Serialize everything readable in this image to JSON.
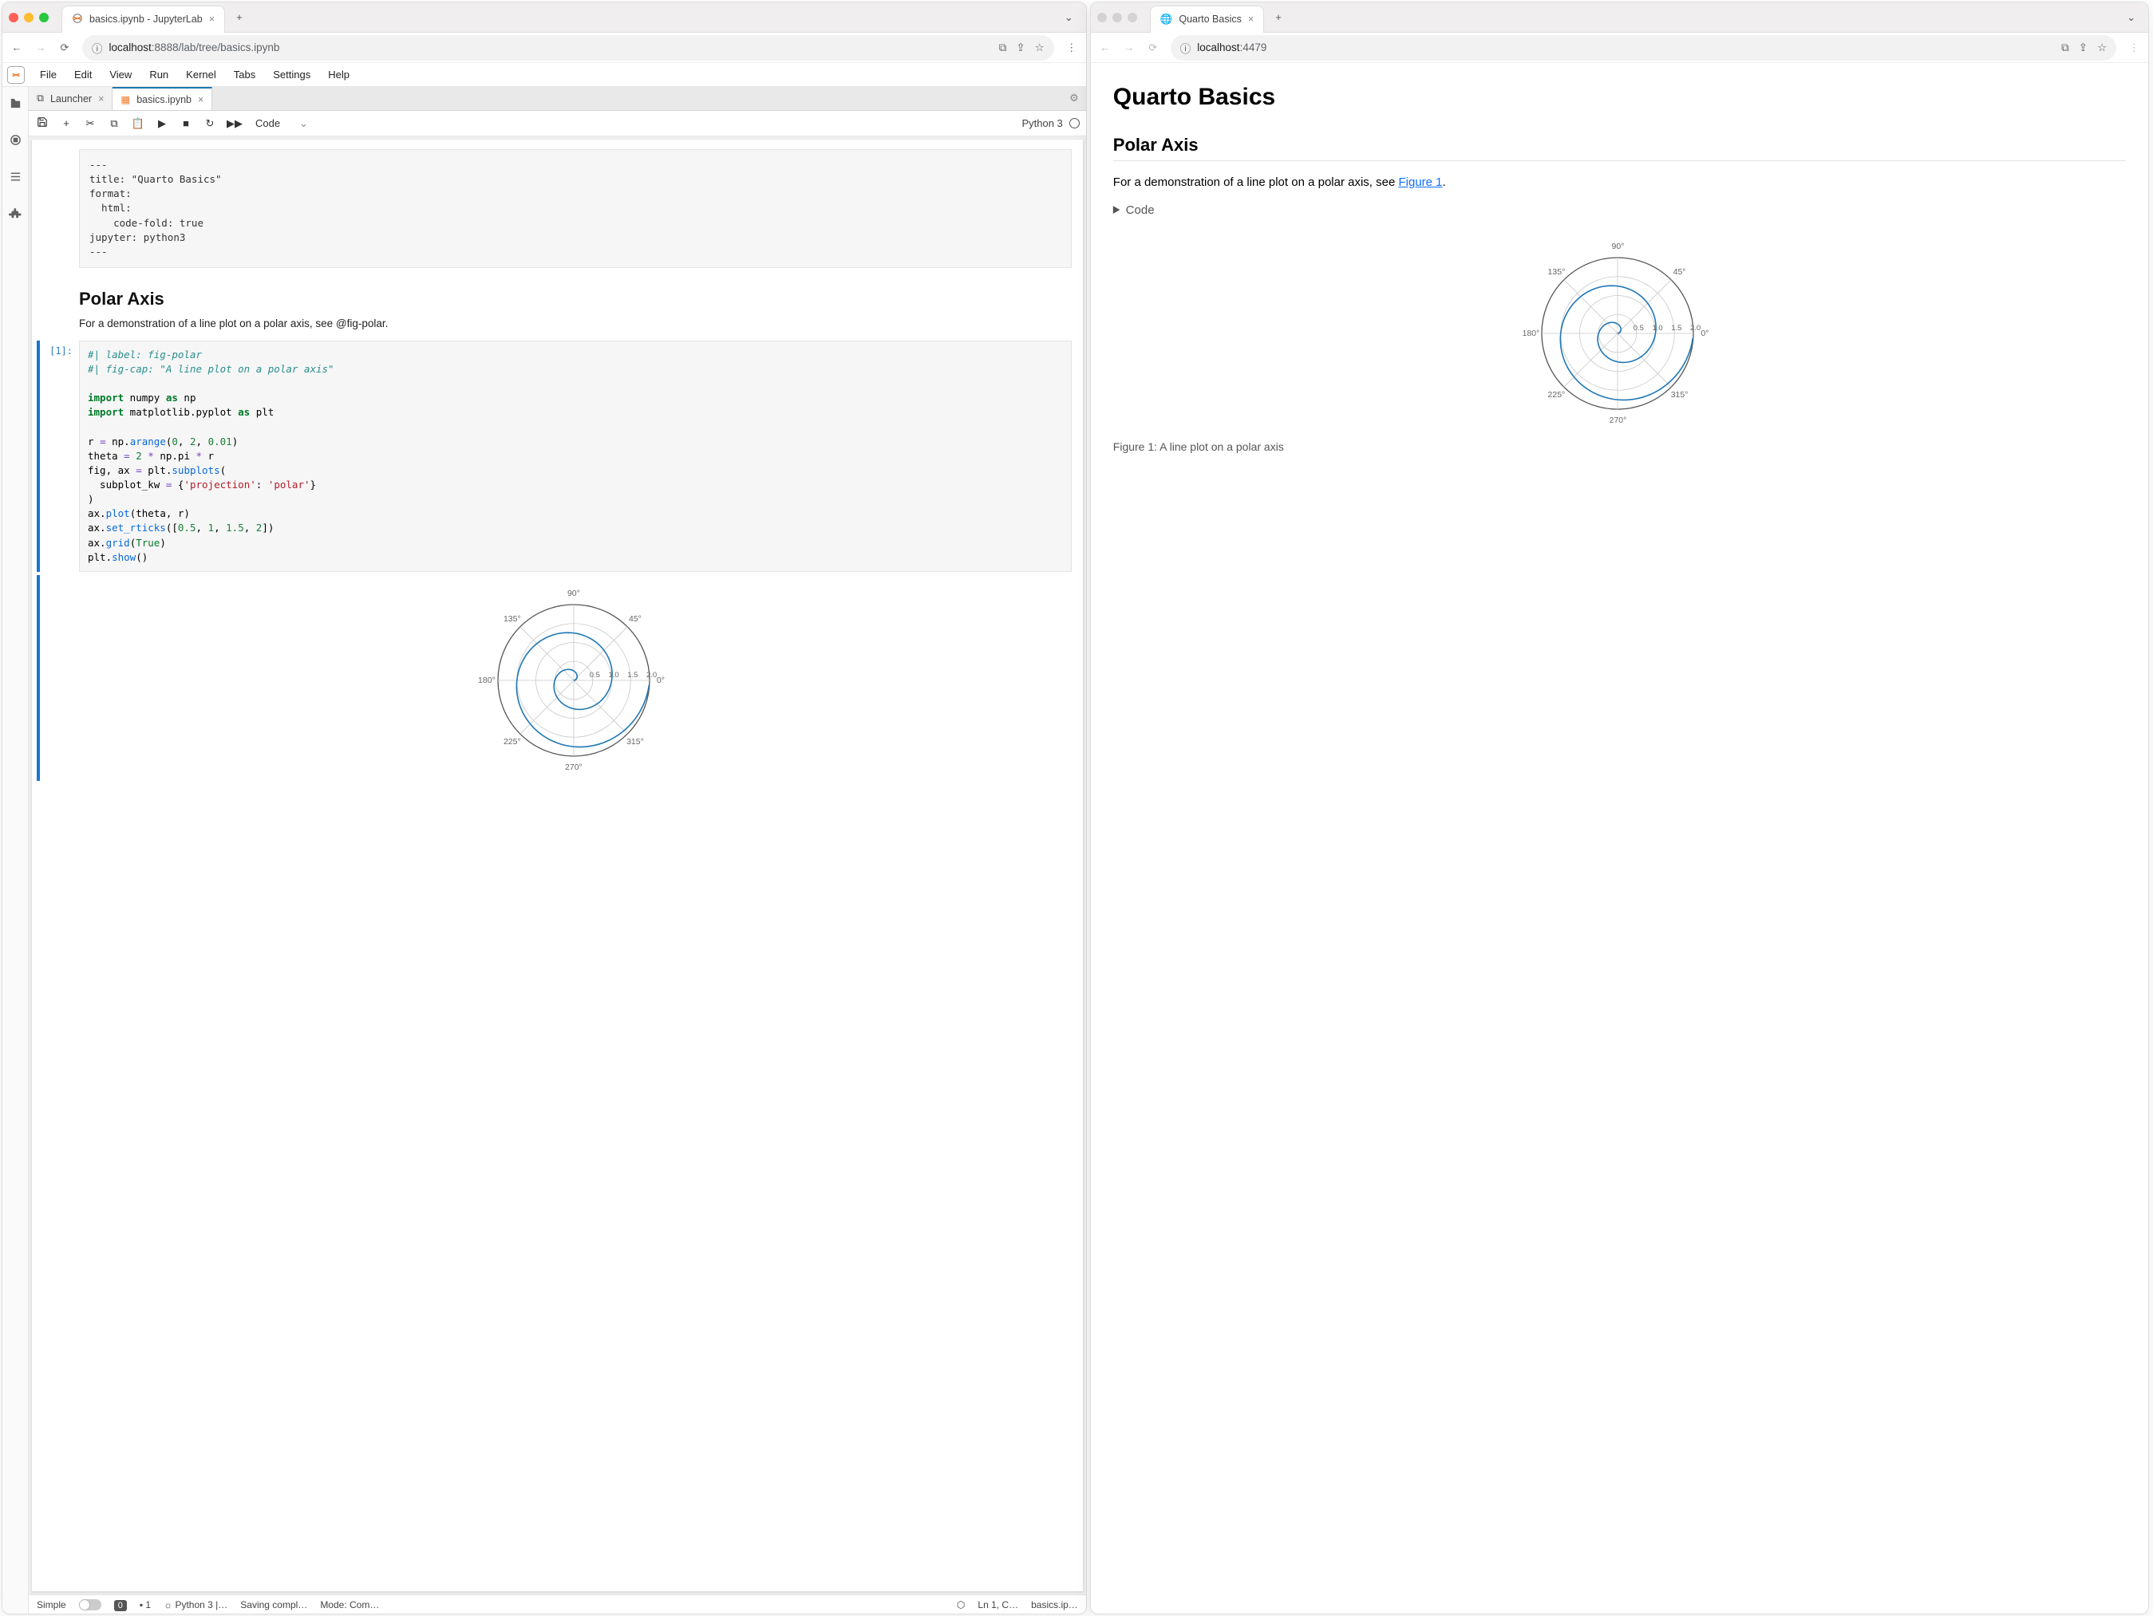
{
  "left_browser": {
    "tab_title": "basics.ipynb - JupyterLab",
    "url_host": "localhost",
    "url_port": ":8888",
    "url_path": "/lab/tree/basics.ipynb"
  },
  "right_browser": {
    "tab_title": "Quarto Basics",
    "url_host": "localhost",
    "url_port": ":4479",
    "url_path": ""
  },
  "jupyter": {
    "menu": [
      "File",
      "Edit",
      "View",
      "Run",
      "Kernel",
      "Tabs",
      "Settings",
      "Help"
    ],
    "doc_tabs": [
      {
        "label": "Launcher",
        "active": false,
        "icon": "launcher"
      },
      {
        "label": "basics.ipynb",
        "active": true,
        "icon": "nb"
      }
    ],
    "toolbar_celltype": "Code",
    "kernel_label": "Python 3",
    "raw_cell": "---\ntitle: \"Quarto Basics\"\nformat:\n  html:\n    code-fold: true\njupyter: python3\n---",
    "md_heading": "Polar Axis",
    "md_text": "For a demonstration of a line plot on a polar axis, see @fig-polar.",
    "code_prompt": "[1]:",
    "status": {
      "simple": "Simple",
      "errors": "0",
      "terminals": "1",
      "kernel": "Python 3 |…",
      "save": "Saving compl…",
      "mode": "Mode: Com…",
      "ln": "Ln 1, C…",
      "file": "basics.ip…"
    }
  },
  "quarto": {
    "h1": "Quarto Basics",
    "h2": "Polar Axis",
    "intro_pre": "For a demonstration of a line plot on a polar axis, see ",
    "link": "Figure 1",
    "intro_post": ".",
    "code_summary": "Code",
    "figcap": "Figure 1: A line plot on a polar axis"
  },
  "chart_data": {
    "type": "polar-line",
    "title": "",
    "r_expr": "np.arange(0, 2, 0.01)",
    "theta_expr": "2 * np.pi * r",
    "rticks": [
      0.5,
      1.0,
      1.5,
      2.0
    ],
    "angle_ticks_deg": [
      0,
      45,
      90,
      135,
      180,
      225,
      270,
      315
    ],
    "grid": true,
    "series": [
      {
        "name": "spiral",
        "r_range": [
          0,
          2
        ],
        "r_step": 0.01,
        "theta_formula": "2*pi*r"
      }
    ]
  },
  "code_tokens": [
    [
      {
        "t": "#| label: fig-polar",
        "c": "c-it"
      }
    ],
    [
      {
        "t": "#| fig-cap: \"A line plot on a polar axis\"",
        "c": "c-it"
      }
    ],
    [],
    [
      {
        "t": "import",
        "c": "kw"
      },
      {
        "t": " numpy "
      },
      {
        "t": "as",
        "c": "as"
      },
      {
        "t": " np"
      }
    ],
    [
      {
        "t": "import",
        "c": "kw"
      },
      {
        "t": " matplotlib.pyplot "
      },
      {
        "t": "as",
        "c": "as"
      },
      {
        "t": " plt"
      }
    ],
    [],
    [
      {
        "t": "r "
      },
      {
        "t": "=",
        "c": "op"
      },
      {
        "t": " np."
      },
      {
        "t": "arange",
        "c": "fn"
      },
      {
        "t": "("
      },
      {
        "t": "0",
        "c": "num"
      },
      {
        "t": ", "
      },
      {
        "t": "2",
        "c": "num"
      },
      {
        "t": ", "
      },
      {
        "t": "0.01",
        "c": "num"
      },
      {
        "t": ")"
      }
    ],
    [
      {
        "t": "theta "
      },
      {
        "t": "=",
        "c": "op"
      },
      {
        "t": " "
      },
      {
        "t": "2",
        "c": "num"
      },
      {
        "t": " "
      },
      {
        "t": "*",
        "c": "op"
      },
      {
        "t": " np.pi "
      },
      {
        "t": "*",
        "c": "op"
      },
      {
        "t": " r"
      }
    ],
    [
      {
        "t": "fig, ax "
      },
      {
        "t": "=",
        "c": "op"
      },
      {
        "t": " plt."
      },
      {
        "t": "subplots",
        "c": "fn"
      },
      {
        "t": "("
      }
    ],
    [
      {
        "t": "  subplot_kw "
      },
      {
        "t": "=",
        "c": "op"
      },
      {
        "t": " {"
      },
      {
        "t": "'projection'",
        "c": "str"
      },
      {
        "t": ": "
      },
      {
        "t": "'polar'",
        "c": "str"
      },
      {
        "t": "}"
      }
    ],
    [
      {
        "t": ")"
      }
    ],
    [
      {
        "t": "ax."
      },
      {
        "t": "plot",
        "c": "fn"
      },
      {
        "t": "(theta, r)"
      }
    ],
    [
      {
        "t": "ax."
      },
      {
        "t": "set_rticks",
        "c": "fn"
      },
      {
        "t": "(["
      },
      {
        "t": "0.5",
        "c": "num"
      },
      {
        "t": ", "
      },
      {
        "t": "1",
        "c": "num"
      },
      {
        "t": ", "
      },
      {
        "t": "1.5",
        "c": "num"
      },
      {
        "t": ", "
      },
      {
        "t": "2",
        "c": "num"
      },
      {
        "t": "])"
      }
    ],
    [
      {
        "t": "ax."
      },
      {
        "t": "grid",
        "c": "fn"
      },
      {
        "t": "("
      },
      {
        "t": "True",
        "c": "bif"
      },
      {
        "t": ")"
      }
    ],
    [
      {
        "t": "plt."
      },
      {
        "t": "show",
        "c": "fn"
      },
      {
        "t": "()"
      }
    ]
  ]
}
